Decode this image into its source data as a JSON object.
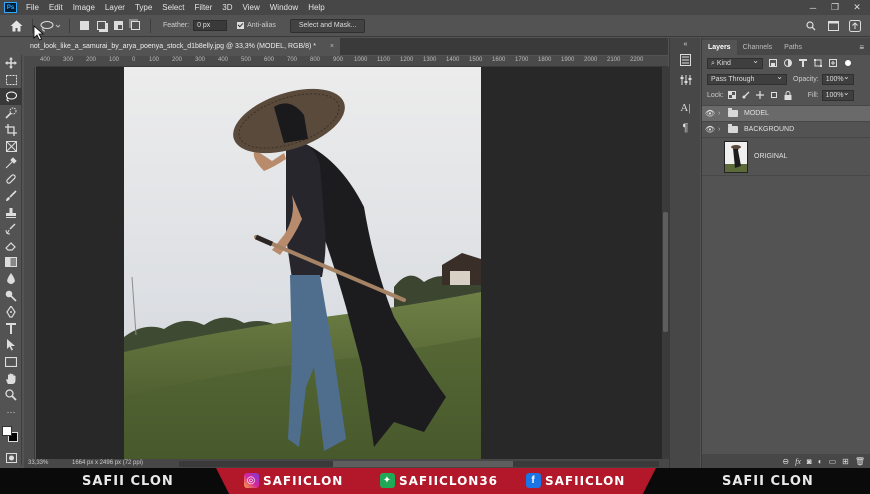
{
  "menubar": {
    "logo": "Ps",
    "items": [
      "File",
      "Edit",
      "Image",
      "Layer",
      "Type",
      "Select",
      "Filter",
      "3D",
      "View",
      "Window",
      "Help"
    ]
  },
  "options": {
    "feather_label": "Feather:",
    "feather_value": "0 px",
    "antialias_label": "Anti-alias",
    "select_mask_label": "Select and Mask..."
  },
  "document": {
    "tab_title": "not_look_like_a_samurai_by_arya_poenya_stock_d1b8elly.jpg @ 33,3% (MODEL, RGB/8) *",
    "close": "×",
    "zoom": "33,33%",
    "dims": "1664 px x 2496 px (72 ppi)"
  },
  "ruler": {
    "ticks": [
      "400",
      "300",
      "200",
      "100",
      "0",
      "100",
      "200",
      "300",
      "400",
      "500",
      "600",
      "700",
      "800",
      "900",
      "1000",
      "1100",
      "1200",
      "1300",
      "1400",
      "1500",
      "1600",
      "1700",
      "1800",
      "1900",
      "2000",
      "2100",
      "2200"
    ]
  },
  "layers_panel": {
    "tabs": [
      "Layers",
      "Channels",
      "Paths"
    ],
    "kind_label": "Kind",
    "blend_mode": "Pass Through",
    "opacity_label": "Opacity:",
    "opacity_value": "100%",
    "lock_label": "Lock:",
    "fill_label": "Fill:",
    "fill_value": "100%",
    "layers": [
      {
        "name": "MODEL"
      },
      {
        "name": "BACKGROUND"
      },
      {
        "name": "ORIGINAL"
      }
    ]
  },
  "banner": {
    "left_name": "SAFII CLON",
    "instagram": "SAFIICLON",
    "game": "SAFIICLON36",
    "facebook": "SAFIICLON",
    "right_name": "SAFII CLON"
  },
  "colors": {
    "accent": "#31a8ff",
    "banner_red": "#b3182a"
  }
}
